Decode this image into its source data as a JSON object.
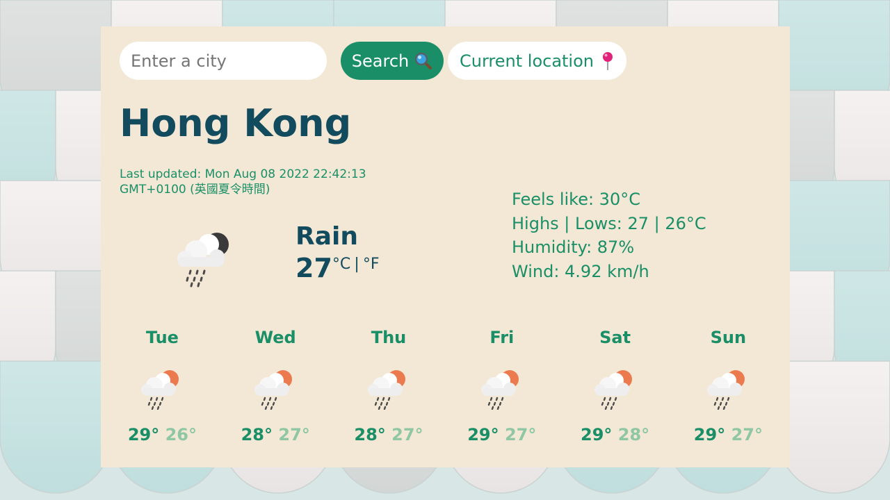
{
  "search": {
    "placeholder": "Enter a city",
    "value": "",
    "search_label": "Search",
    "search_icon": "magnifying-glass-icon",
    "current_location_label": "Current location",
    "current_location_icon": "pushpin-icon"
  },
  "weather": {
    "city": "Hong Kong",
    "last_updated": "Last updated: Mon Aug 08 2022 22:42:13 GMT+0100 (英國夏令時間)",
    "description": "Rain",
    "icon": "rain-night-icon",
    "temperature": "27",
    "unit_c": "°C",
    "unit_separator": "|",
    "unit_f": "°F",
    "feels_like": "Feels like: 30°C",
    "highs_lows": "Highs | Lows: 27 | 26°C",
    "humidity": "Humidity: 87%",
    "wind": "Wind: 4.92 km/h"
  },
  "forecast": [
    {
      "day": "Tue",
      "high": "29°",
      "low": "26°",
      "icon": "rain-day-icon"
    },
    {
      "day": "Wed",
      "high": "28°",
      "low": "27°",
      "icon": "rain-day-icon"
    },
    {
      "day": "Thu",
      "high": "28°",
      "low": "27°",
      "icon": "rain-day-icon"
    },
    {
      "day": "Fri",
      "high": "29°",
      "low": "27°",
      "icon": "rain-day-icon"
    },
    {
      "day": "Sat",
      "high": "29°",
      "low": "28°",
      "icon": "rain-day-icon"
    },
    {
      "day": "Sun",
      "high": "29°",
      "low": "27°",
      "icon": "rain-day-icon"
    }
  ],
  "colors": {
    "card_background": "#f3e8d5",
    "accent_green": "#1a8f67",
    "title_navy": "#124a5e",
    "low_temp_green": "#8fc7a4",
    "sun_orange": "#ec7a4f",
    "moon_dark": "#3a3a3a"
  }
}
